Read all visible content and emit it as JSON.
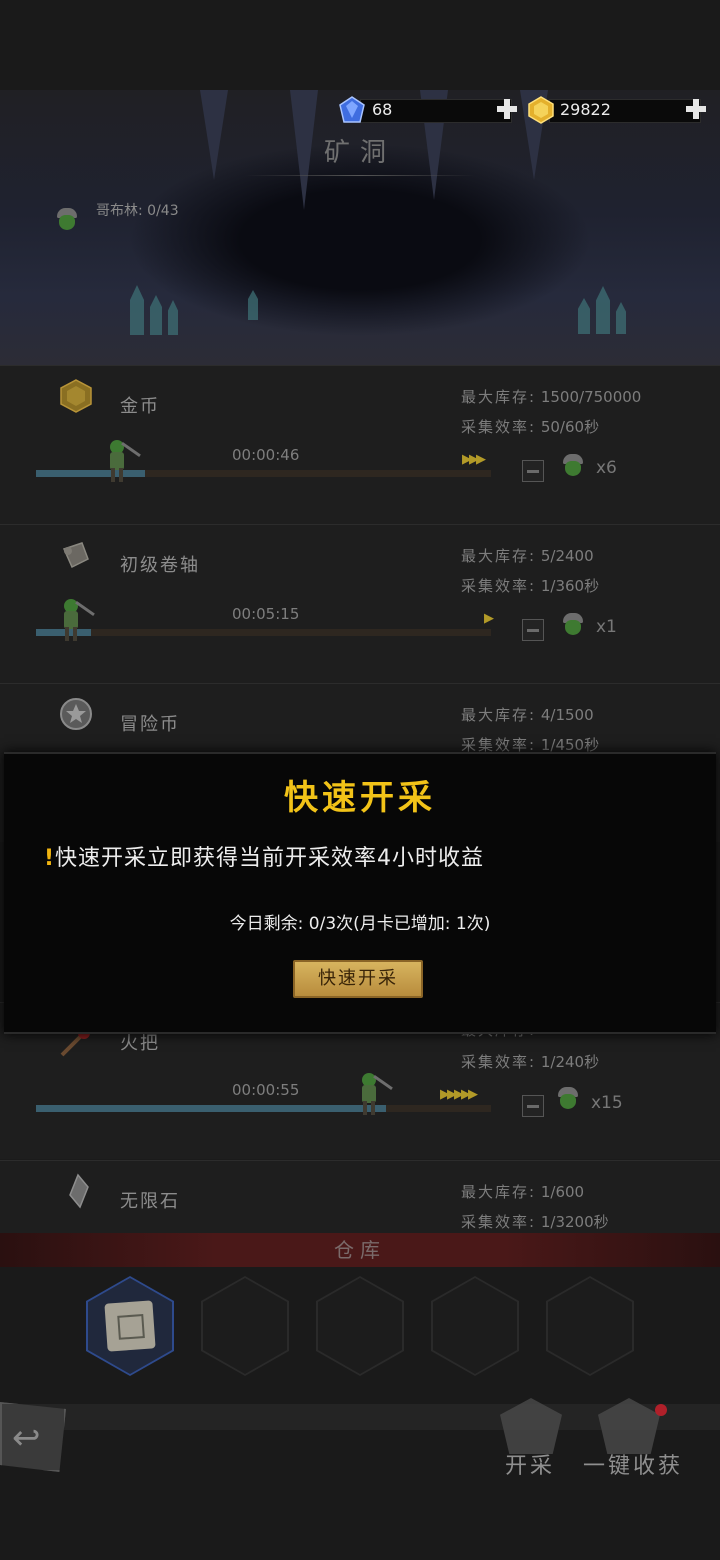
{
  "header": {
    "gems": "68",
    "gold": "29822",
    "title": "矿洞",
    "goblin_count": "哥布林: 0/43"
  },
  "rows": [
    {
      "name": "金币",
      "capacity_label": "最大库存:",
      "capacity_value": "1500/750000",
      "rate_label": "采集效率:",
      "rate_value": "50/60秒",
      "timer": "00:00:46",
      "arrows": "▶▶▶",
      "multiplier": "x6",
      "progress": 0.24,
      "icon": "gold-gem-icon"
    },
    {
      "name": "初级卷轴",
      "capacity_label": "最大库存:",
      "capacity_value": "5/2400",
      "rate_label": "采集效率:",
      "rate_value": "1/360秒",
      "timer": "00:05:15",
      "arrows": "▶",
      "multiplier": "x1",
      "progress": 0.12,
      "icon": "scroll-icon"
    },
    {
      "name": "冒险币",
      "capacity_label": "最大库存:",
      "capacity_value": "4/1500",
      "rate_label": "采集效率:",
      "rate_value": "1/450秒",
      "icon": "adventure-coin-icon"
    },
    {
      "name": "火把",
      "capacity_label": "最大库存:",
      "capacity_value": "",
      "rate_label": "采集效率:",
      "rate_value": "1/240秒",
      "timer": "00:00:55",
      "arrows": "▶▶▶▶▶",
      "multiplier": "x15",
      "progress": 0.77,
      "icon": "torch-icon"
    },
    {
      "name": "无限石",
      "capacity_label": "最大库存:",
      "capacity_value": "1/600",
      "rate_label": "采集效率:",
      "rate_value": "1/3200秒",
      "icon": "infinity-stone-icon"
    }
  ],
  "dialog": {
    "title": "快速开采",
    "warning_mark": "!",
    "warning": "快速开采立即获得当前开采效率4小时收益",
    "remaining": "今日剩余: 0/3次(月卡已增加: 1次)",
    "button": "快速开采"
  },
  "warehouse": {
    "title": "仓库"
  },
  "actions": {
    "mine": "开采",
    "collect_all": "一键收获"
  },
  "colors": {
    "dialog_title": "#f2c318",
    "progress_fill": "#3a5f6f",
    "arrow": "#b29a28",
    "warehouse_bar": "#4a1818"
  }
}
